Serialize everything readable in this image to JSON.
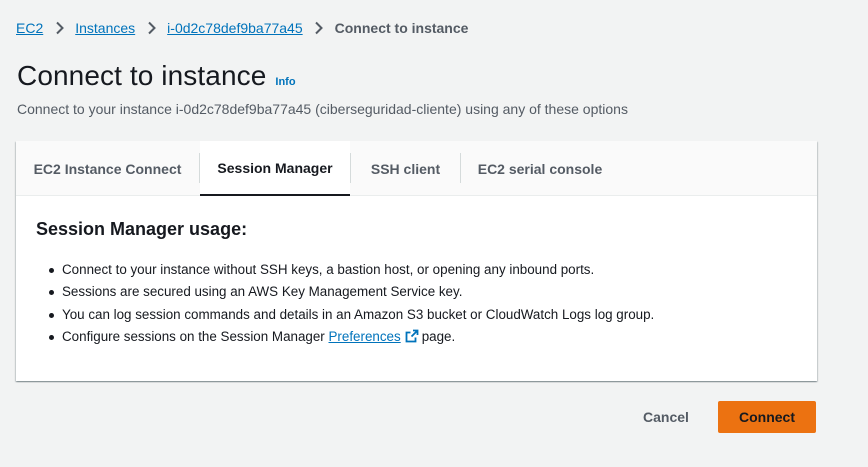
{
  "breadcrumb": {
    "items": [
      "EC2",
      "Instances",
      "i-0d2c78def9ba77a45"
    ],
    "current": "Connect to instance"
  },
  "header": {
    "title": "Connect to instance",
    "info": "Info",
    "subtitle": "Connect to your instance i-0d2c78def9ba77a45 (ciberseguridad-cliente) using any of these options"
  },
  "tabs": [
    {
      "label": "EC2 Instance Connect",
      "active": false
    },
    {
      "label": "Session Manager",
      "active": true
    },
    {
      "label": "SSH client",
      "active": false
    },
    {
      "label": "EC2 serial console",
      "active": false
    }
  ],
  "session_manager": {
    "heading": "Session Manager usage:",
    "bullets": [
      "Connect to your instance without SSH keys, a bastion host, or opening any inbound ports.",
      "Sessions are secured using an AWS Key Management Service key.",
      "You can log session commands and details in an Amazon S3 bucket or CloudWatch Logs log group."
    ],
    "configure_prefix": "Configure sessions on the Session Manager",
    "preferences_link": "Preferences",
    "configure_suffix": "page."
  },
  "footer": {
    "cancel_label": "Cancel",
    "connect_label": "Connect"
  },
  "colors": {
    "link": "#0073bb",
    "primary_button": "#ec7211",
    "background": "#f2f3f3",
    "text": "#16191f",
    "muted_text": "#545b64"
  }
}
